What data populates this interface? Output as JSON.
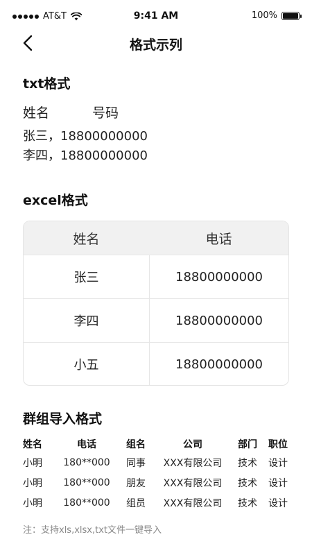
{
  "status_bar": {
    "carrier": "AT&T",
    "time": "9:41 AM",
    "battery": "100%"
  },
  "nav": {
    "title": "格式示列"
  },
  "txt_section": {
    "title": "txt格式",
    "header_name": "姓名",
    "header_number": "号码",
    "lines": [
      "张三，18800000000",
      "李四，18800000000"
    ]
  },
  "excel_section": {
    "title": "excel格式",
    "headers": [
      "姓名",
      "电话"
    ],
    "rows": [
      [
        "张三",
        "18800000000"
      ],
      [
        "李四",
        "18800000000"
      ],
      [
        "小五",
        "18800000000"
      ]
    ]
  },
  "group_section": {
    "title": "群组导入格式",
    "headers": [
      "姓名",
      "电话",
      "组名",
      "公司",
      "部门",
      "职位"
    ],
    "rows": [
      [
        "小明",
        "180**000",
        "同事",
        "XXX有限公司",
        "技术",
        "设计"
      ],
      [
        "小明",
        "180**000",
        "朋友",
        "XXX有限公司",
        "技术",
        "设计"
      ],
      [
        "小明",
        "180**000",
        "组员",
        "XXX有限公司",
        "技术",
        "设计"
      ]
    ]
  },
  "note": "注：支持xls,xlsx,txt文件一键导入",
  "icons": {
    "back": "chevron-left-icon",
    "signal": "signal-dots-icon",
    "wifi": "wifi-icon",
    "battery": "battery-icon"
  }
}
